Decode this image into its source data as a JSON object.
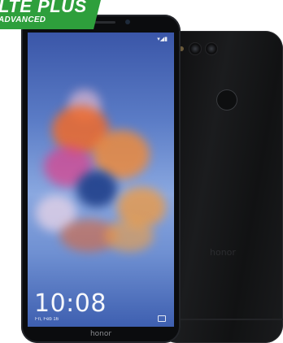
{
  "banner": {
    "title": "LTE PLUS",
    "subtitle": "ADVANCED"
  },
  "front_phone": {
    "clock": "10:08",
    "date": "Fri, Feb 16",
    "logo": "honor"
  },
  "back_phone": {
    "logo": "honor"
  },
  "colors": {
    "banner_green": "#2e9f3c",
    "phone_black": "#0b0c0e"
  }
}
